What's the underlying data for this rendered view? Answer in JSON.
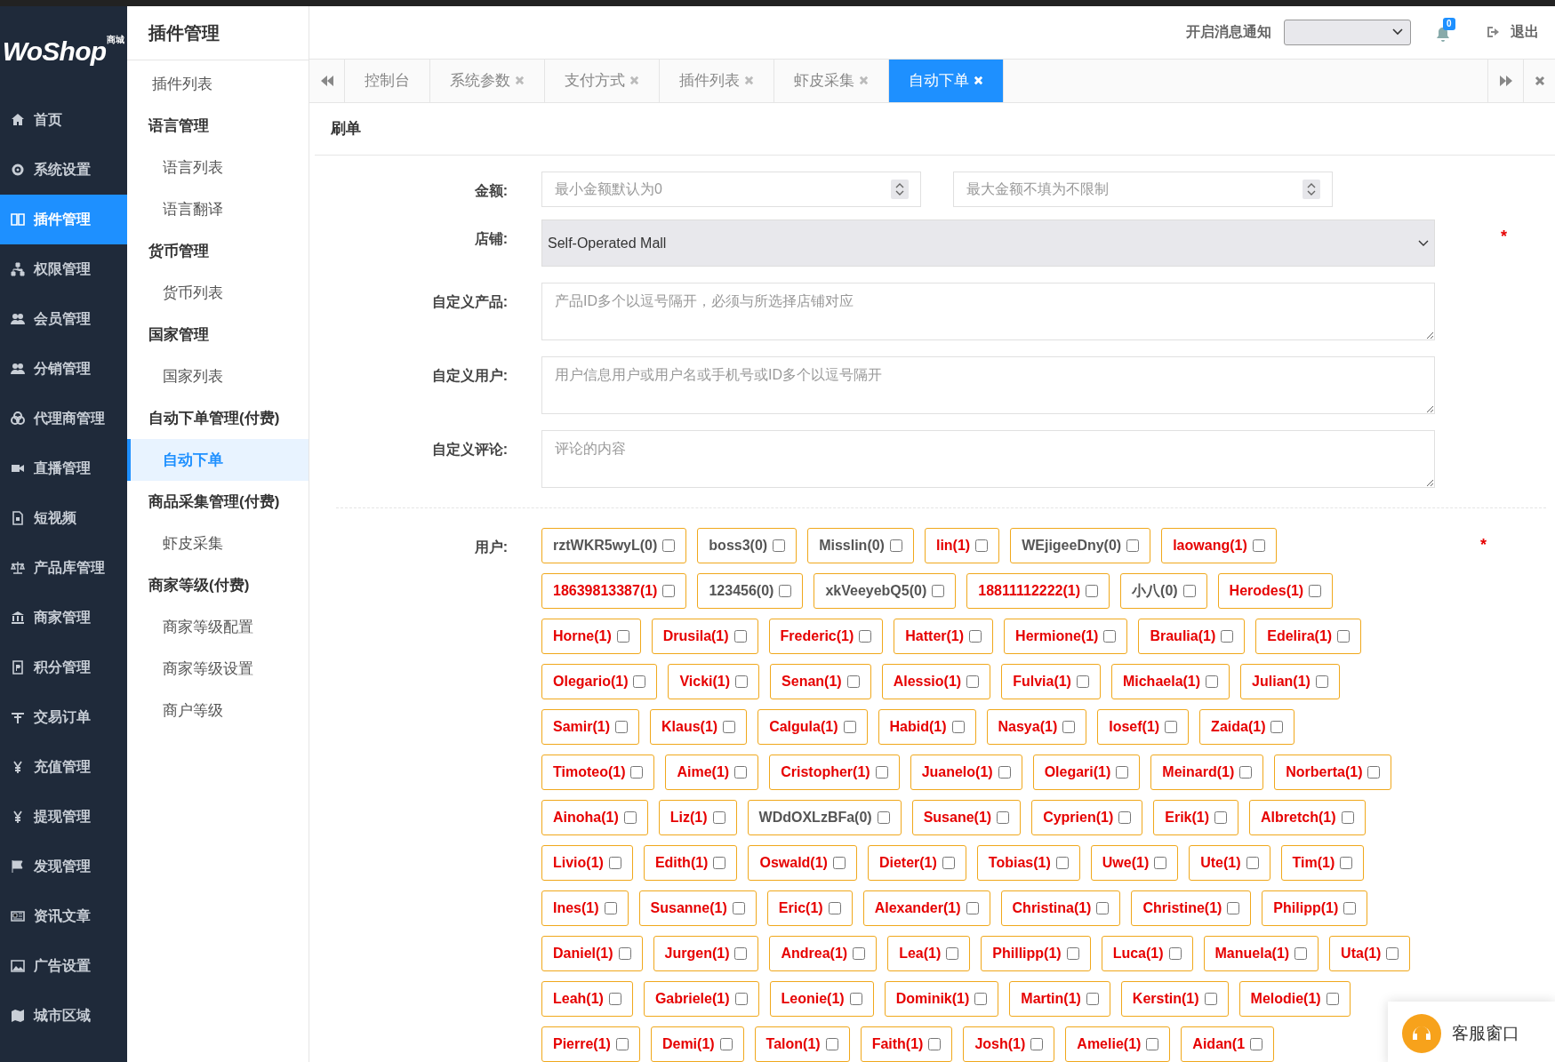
{
  "logo": {
    "text": "WoShop",
    "badge": "商城"
  },
  "sidebar": {
    "items": [
      {
        "label": "首页",
        "selected": false
      },
      {
        "label": "系统设置",
        "selected": false
      },
      {
        "label": "插件管理",
        "selected": true
      },
      {
        "label": "权限管理",
        "selected": false
      },
      {
        "label": "会员管理",
        "selected": false
      },
      {
        "label": "分销管理",
        "selected": false
      },
      {
        "label": "代理商管理",
        "selected": false
      },
      {
        "label": "直播管理",
        "selected": false
      },
      {
        "label": "短视频",
        "selected": false
      },
      {
        "label": "产品库管理",
        "selected": false
      },
      {
        "label": "商家管理",
        "selected": false
      },
      {
        "label": "积分管理",
        "selected": false
      },
      {
        "label": "交易订单",
        "selected": false
      },
      {
        "label": "充值管理",
        "selected": false
      },
      {
        "label": "提现管理",
        "selected": false
      },
      {
        "label": "发现管理",
        "selected": false
      },
      {
        "label": "资讯文章",
        "selected": false
      },
      {
        "label": "广告设置",
        "selected": false
      },
      {
        "label": "城市区域",
        "selected": false
      }
    ]
  },
  "submenu": {
    "title": "插件管理",
    "items": [
      {
        "kind": "link",
        "label": "插件列表",
        "selected": false
      },
      {
        "kind": "group",
        "label": "语言管理"
      },
      {
        "kind": "sublink",
        "label": "语言列表",
        "selected": false
      },
      {
        "kind": "sublink",
        "label": "语言翻译",
        "selected": false
      },
      {
        "kind": "group",
        "label": "货币管理"
      },
      {
        "kind": "sublink",
        "label": "货币列表",
        "selected": false
      },
      {
        "kind": "group",
        "label": "国家管理"
      },
      {
        "kind": "sublink",
        "label": "国家列表",
        "selected": false
      },
      {
        "kind": "group",
        "label": "自动下单管理(付费)"
      },
      {
        "kind": "sublink",
        "label": "自动下单",
        "selected": true
      },
      {
        "kind": "group",
        "label": "商品采集管理(付费)"
      },
      {
        "kind": "sublink",
        "label": "虾皮采集",
        "selected": false
      },
      {
        "kind": "group",
        "label": "商家等级(付费)"
      },
      {
        "kind": "sublink",
        "label": "商家等级配置",
        "selected": false
      },
      {
        "kind": "sublink",
        "label": "商家等级设置",
        "selected": false
      },
      {
        "kind": "sublink",
        "label": "商户等级",
        "selected": false
      }
    ]
  },
  "topbar": {
    "notify_label": "开启消息通知",
    "notice_count": "0",
    "logout": "退出"
  },
  "tabs": [
    {
      "label": "控制台",
      "selected": false,
      "closable": false
    },
    {
      "label": "系统参数",
      "selected": false,
      "closable": true
    },
    {
      "label": "支付方式",
      "selected": false,
      "closable": true
    },
    {
      "label": "插件列表",
      "selected": false,
      "closable": true
    },
    {
      "label": "虾皮采集",
      "selected": false,
      "closable": true
    },
    {
      "label": "自动下单",
      "selected": true,
      "closable": true
    }
  ],
  "section_title": "刷单",
  "form": {
    "amount": {
      "label": "金额:",
      "min_placeholder": "最小金额默认为0",
      "max_placeholder": "最大金额不填为不限制"
    },
    "store": {
      "label": "店铺:",
      "value": "Self-Operated Mall",
      "required_mark": "*"
    },
    "textareas": [
      {
        "label": "自定义产品:",
        "placeholder": "产品ID多个以逗号隔开，必须与所选择店铺对应"
      },
      {
        "label": "自定义用户:",
        "placeholder": "用户信息用户或用户名或手机号或ID多个以逗号隔开"
      },
      {
        "label": "自定义评论:",
        "placeholder": "评论的内容"
      }
    ],
    "users": {
      "label": "用户:",
      "required_mark": "*",
      "items": [
        {
          "label": "rztWKR5wyL(0)",
          "color": "#555555",
          "checked": false
        },
        {
          "label": "boss3(0)",
          "color": "#555555",
          "checked": false
        },
        {
          "label": "Misslin(0)",
          "color": "#555555",
          "checked": false
        },
        {
          "label": "lin(1)",
          "color": "#e60000",
          "checked": false
        },
        {
          "label": "WEjigeeDny(0)",
          "color": "#555555",
          "checked": false
        },
        {
          "label": "laowang(1)",
          "color": "#e60000",
          "checked": false
        },
        {
          "label": "18639813387(1)",
          "color": "#e60000",
          "checked": false
        },
        {
          "label": "123456(0)",
          "color": "#555555",
          "checked": false
        },
        {
          "label": "xkVeeyebQ5(0)",
          "color": "#555555",
          "checked": false
        },
        {
          "label": "18811112222(1)",
          "color": "#e60000",
          "checked": false
        },
        {
          "label": "小八(0)",
          "color": "#555555",
          "checked": false
        },
        {
          "label": "Herodes(1)",
          "color": "#e60000",
          "checked": false
        },
        {
          "label": "Horne(1)",
          "color": "#e60000",
          "checked": false
        },
        {
          "label": "Drusila(1)",
          "color": "#e60000",
          "checked": false
        },
        {
          "label": "Frederic(1)",
          "color": "#e60000",
          "checked": false
        },
        {
          "label": "Hatter(1)",
          "color": "#e60000",
          "checked": false
        },
        {
          "label": "Hermione(1)",
          "color": "#e60000",
          "checked": false
        },
        {
          "label": "Braulia(1)",
          "color": "#e60000",
          "checked": false
        },
        {
          "label": "Edelira(1)",
          "color": "#e60000",
          "checked": false
        },
        {
          "label": "Olegario(1)",
          "color": "#e60000",
          "checked": false
        },
        {
          "label": "Vicki(1)",
          "color": "#e60000",
          "checked": false
        },
        {
          "label": "Senan(1)",
          "color": "#e60000",
          "checked": false
        },
        {
          "label": "Alessio(1)",
          "color": "#e60000",
          "checked": false
        },
        {
          "label": "Fulvia(1)",
          "color": "#e60000",
          "checked": false
        },
        {
          "label": "Michaela(1)",
          "color": "#e60000",
          "checked": false
        },
        {
          "label": "Julian(1)",
          "color": "#e60000",
          "checked": false
        },
        {
          "label": "Samir(1)",
          "color": "#e60000",
          "checked": false
        },
        {
          "label": "Klaus(1)",
          "color": "#e60000",
          "checked": false
        },
        {
          "label": "Calgula(1)",
          "color": "#e60000",
          "checked": false
        },
        {
          "label": "Habid(1)",
          "color": "#e60000",
          "checked": false
        },
        {
          "label": "Nasya(1)",
          "color": "#e60000",
          "checked": false
        },
        {
          "label": "Iosef(1)",
          "color": "#e60000",
          "checked": false
        },
        {
          "label": "Zaida(1)",
          "color": "#e60000",
          "checked": false
        },
        {
          "label": "Timoteo(1)",
          "color": "#e60000",
          "checked": false
        },
        {
          "label": "Aime(1)",
          "color": "#e60000",
          "checked": false
        },
        {
          "label": "Cristopher(1)",
          "color": "#e60000",
          "checked": false
        },
        {
          "label": "Juanelo(1)",
          "color": "#e60000",
          "checked": false
        },
        {
          "label": "Olegari(1)",
          "color": "#e60000",
          "checked": false
        },
        {
          "label": "Meinard(1)",
          "color": "#e60000",
          "checked": false
        },
        {
          "label": "Norberta(1)",
          "color": "#e60000",
          "checked": false
        },
        {
          "label": "Ainoha(1)",
          "color": "#e60000",
          "checked": false
        },
        {
          "label": "Liz(1)",
          "color": "#e60000",
          "checked": false
        },
        {
          "label": "WDdOXLzBFa(0)",
          "color": "#555555",
          "checked": false
        },
        {
          "label": "Susane(1)",
          "color": "#e60000",
          "checked": false
        },
        {
          "label": "Cyprien(1)",
          "color": "#e60000",
          "checked": false
        },
        {
          "label": "Erik(1)",
          "color": "#e60000",
          "checked": false
        },
        {
          "label": "Albretch(1)",
          "color": "#e60000",
          "checked": false
        },
        {
          "label": "Livio(1)",
          "color": "#e60000",
          "checked": false
        },
        {
          "label": "Edith(1)",
          "color": "#e60000",
          "checked": false
        },
        {
          "label": "Oswald(1)",
          "color": "#e60000",
          "checked": false
        },
        {
          "label": "Dieter(1)",
          "color": "#e60000",
          "checked": false
        },
        {
          "label": "Tobias(1)",
          "color": "#e60000",
          "checked": false
        },
        {
          "label": "Uwe(1)",
          "color": "#e60000",
          "checked": false
        },
        {
          "label": "Ute(1)",
          "color": "#e60000",
          "checked": false
        },
        {
          "label": "Tim(1)",
          "color": "#e60000",
          "checked": false
        },
        {
          "label": "Ines(1)",
          "color": "#e60000",
          "checked": false
        },
        {
          "label": "Susanne(1)",
          "color": "#e60000",
          "checked": false
        },
        {
          "label": "Eric(1)",
          "color": "#e60000",
          "checked": false
        },
        {
          "label": "Alexander(1)",
          "color": "#e60000",
          "checked": false
        },
        {
          "label": "Christina(1)",
          "color": "#e60000",
          "checked": false
        },
        {
          "label": "Christine(1)",
          "color": "#e60000",
          "checked": false
        },
        {
          "label": "Philipp(1)",
          "color": "#e60000",
          "checked": false
        },
        {
          "label": "Daniel(1)",
          "color": "#e60000",
          "checked": false
        },
        {
          "label": "Jurgen(1)",
          "color": "#e60000",
          "checked": false
        },
        {
          "label": "Andrea(1)",
          "color": "#e60000",
          "checked": false
        },
        {
          "label": "Lea(1)",
          "color": "#e60000",
          "checked": false
        },
        {
          "label": "Phillipp(1)",
          "color": "#e60000",
          "checked": false
        },
        {
          "label": "Luca(1)",
          "color": "#e60000",
          "checked": false
        },
        {
          "label": "Manuela(1)",
          "color": "#e60000",
          "checked": false
        },
        {
          "label": "Uta(1)",
          "color": "#e60000",
          "checked": false
        },
        {
          "label": "Leah(1)",
          "color": "#e60000",
          "checked": false
        },
        {
          "label": "Gabriele(1)",
          "color": "#e60000",
          "checked": false
        },
        {
          "label": "Leonie(1)",
          "color": "#e60000",
          "checked": false
        },
        {
          "label": "Dominik(1)",
          "color": "#e60000",
          "checked": false
        },
        {
          "label": "Martin(1)",
          "color": "#e60000",
          "checked": false
        },
        {
          "label": "Kerstin(1)",
          "color": "#e60000",
          "checked": false
        },
        {
          "label": "Melodie(1)",
          "color": "#e60000",
          "checked": false
        },
        {
          "label": "Pierre(1)",
          "color": "#e60000",
          "checked": false
        },
        {
          "label": "Demi(1)",
          "color": "#e60000",
          "checked": false
        },
        {
          "label": "Talon(1)",
          "color": "#e60000",
          "checked": false
        },
        {
          "label": "Faith(1)",
          "color": "#e60000",
          "checked": false
        },
        {
          "label": "Josh(1)",
          "color": "#e60000",
          "checked": false
        },
        {
          "label": "Amelie(1)",
          "color": "#e60000",
          "checked": false
        },
        {
          "label": "Aidan(1",
          "color": "#e60000",
          "checked": false
        }
      ]
    }
  },
  "support_widget": {
    "label": "客服窗口"
  }
}
